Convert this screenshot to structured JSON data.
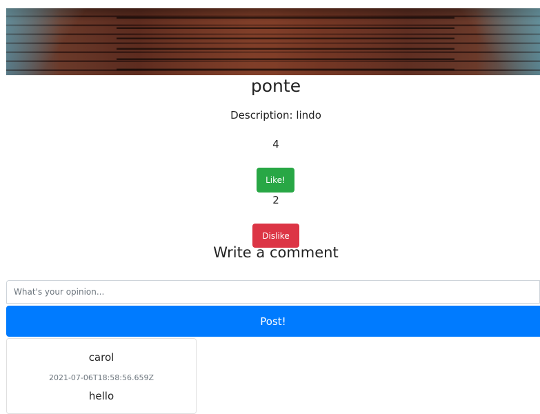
{
  "post": {
    "title": "ponte",
    "description": "Description: lindo",
    "likes_count": "4",
    "like_label": "Like!",
    "dislikes_count": "2",
    "dislike_label": "Dislike"
  },
  "comment_form": {
    "heading": "Write a comment",
    "placeholder": "What's your opinion...",
    "value": "",
    "post_label": "Post!"
  },
  "comments": [
    {
      "user": "carol",
      "timestamp": "2021-07-06T18:58:56.659Z",
      "text": "hello"
    }
  ],
  "colors": {
    "like": "#28a745",
    "dislike": "#dc3545",
    "primary": "#007bff"
  }
}
